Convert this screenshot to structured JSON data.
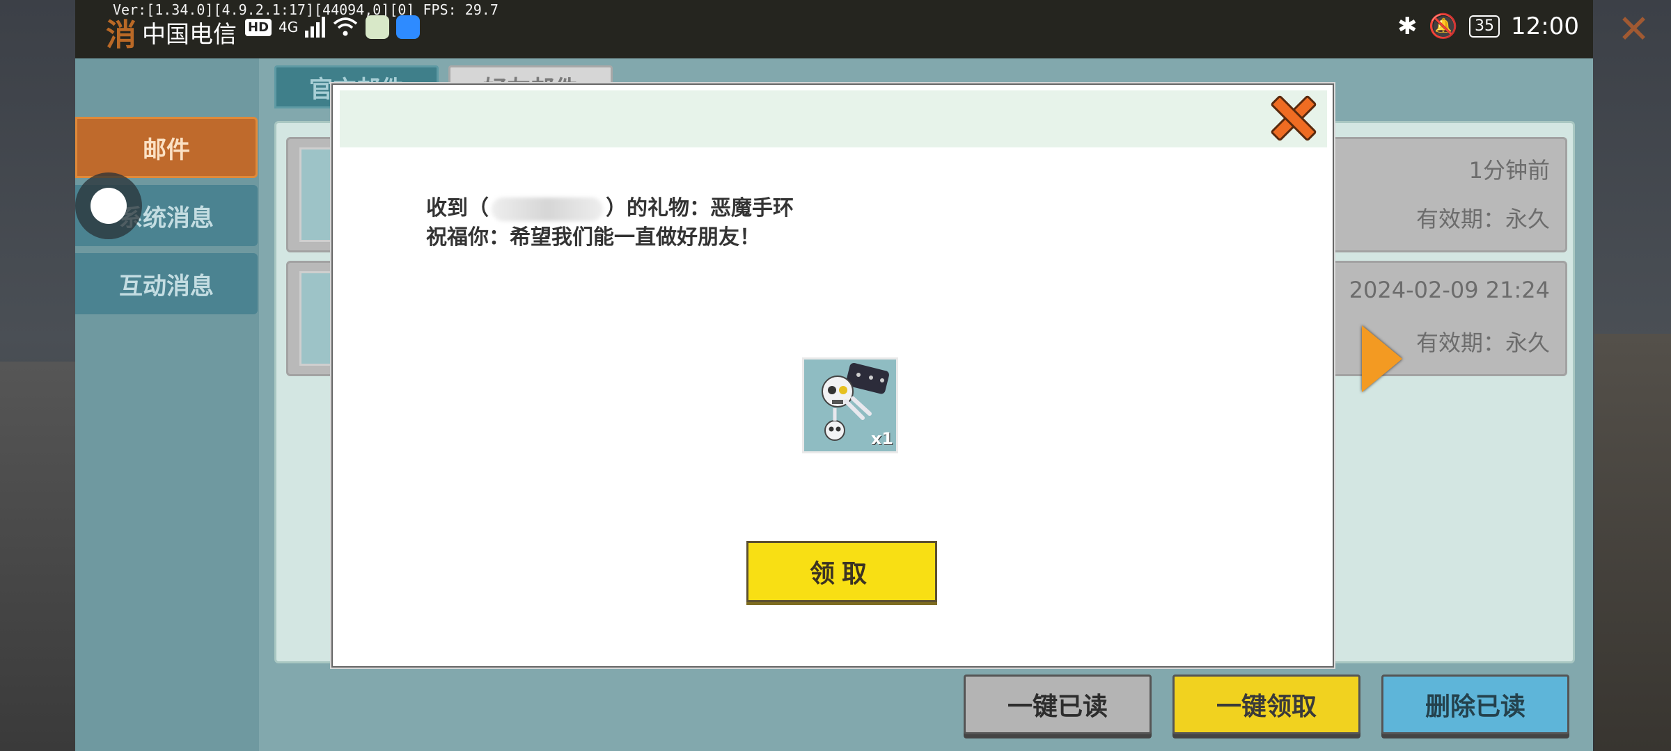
{
  "status_bar": {
    "version": "Ver:[1.34.0][4.9.2.1:17][44094,0][0] FPS: 29.7",
    "carrier": "中国电信",
    "hd_badge": "HD",
    "network": "4G",
    "battery": "35",
    "time": "12:00"
  },
  "window": {
    "title_partial": "消"
  },
  "tabs": [
    {
      "label": "官方邮件"
    },
    {
      "label": "好友邮件"
    }
  ],
  "sidebar": {
    "items": [
      {
        "label": "邮件",
        "active": true
      },
      {
        "label": "系统消息"
      },
      {
        "label": "互动消息"
      }
    ]
  },
  "mail_list": [
    {
      "time": "1分钟前",
      "expiry": "有效期：永久"
    },
    {
      "time": "2024-02-09 21:24",
      "expiry": "有效期：永久"
    }
  ],
  "bottom_actions": {
    "mark_all_read": "一键已读",
    "claim_all": "一键领取",
    "delete_read": "删除已读"
  },
  "modal": {
    "line1_prefix": "收到（",
    "line1_suffix": "）的礼物：恶魔手环",
    "line2": "祝福你：希望我们能一直做好朋友！",
    "gift_count": "x1",
    "claim_label": "领取"
  },
  "colors": {
    "accent_orange": "#ef6c22",
    "claim_yellow": "#f8df14",
    "modal_header": "#e7f3ea"
  }
}
